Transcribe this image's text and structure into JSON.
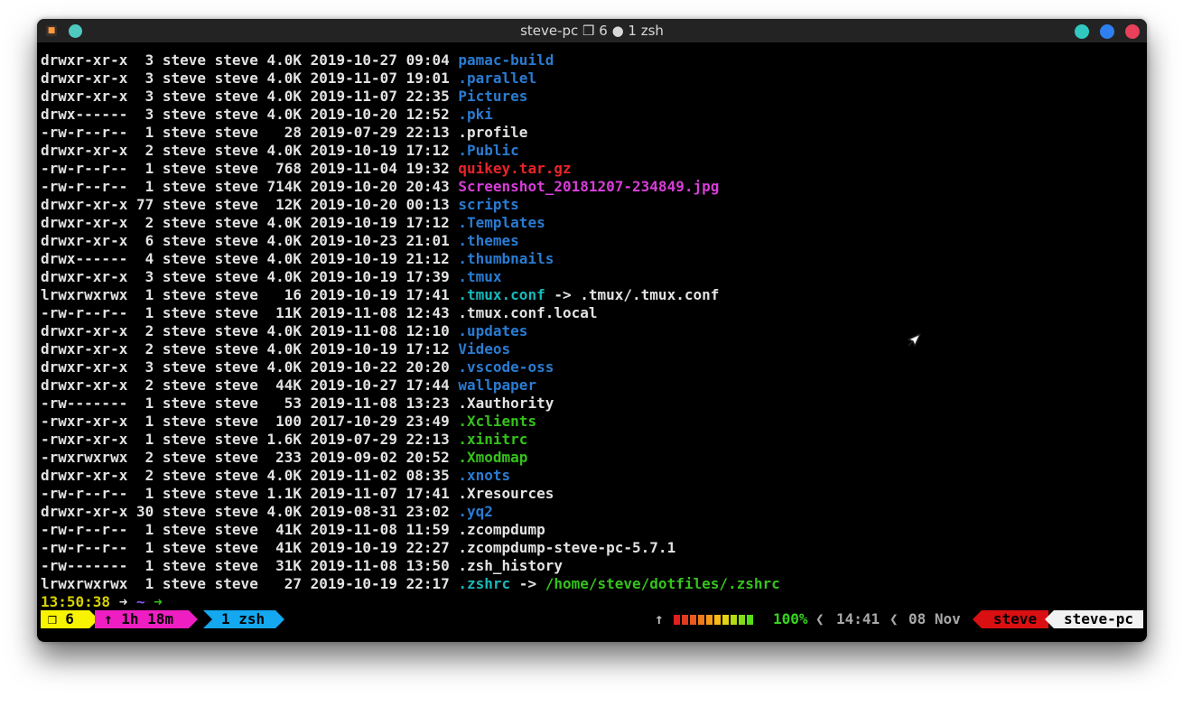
{
  "window": {
    "title": "steve-pc ❒ 6 ● 1 zsh",
    "buttons": [
      "minimize",
      "maximize",
      "close"
    ],
    "button_colors": {
      "pin": "#4fc8c0",
      "minimize": "#30c8c0",
      "maximize": "#2f7ff0",
      "close": "#e8405a"
    }
  },
  "colors": {
    "directory": "#2a7bd2",
    "archive": "#e8242a",
    "image": "#d73ed8",
    "symlink": "#17b9bb",
    "executable": "#35c21c",
    "plain": "#e2e2e2"
  },
  "listing": [
    {
      "meta": "drwxr-xr-x  3 steve steve 4.0K 2019-10-27 09:04 ",
      "name": "pamac-build",
      "kind": "dir"
    },
    {
      "meta": "drwxr-xr-x  3 steve steve 4.0K 2019-11-07 19:01 ",
      "name": ".parallel",
      "kind": "dir"
    },
    {
      "meta": "drwxr-xr-x  3 steve steve 4.0K 2019-11-07 22:35 ",
      "name": "Pictures",
      "kind": "dir"
    },
    {
      "meta": "drwx------  3 steve steve 4.0K 2019-10-20 12:52 ",
      "name": ".pki",
      "kind": "dir"
    },
    {
      "meta": "-rw-r--r--  1 steve steve   28 2019-07-29 22:13 ",
      "name": ".profile",
      "kind": "plain"
    },
    {
      "meta": "drwxr-xr-x  2 steve steve 4.0K 2019-10-19 17:12 ",
      "name": ".Public",
      "kind": "dir"
    },
    {
      "meta": "-rw-r--r--  1 steve steve  768 2019-11-04 19:32 ",
      "name": "quikey.tar.gz",
      "kind": "arch"
    },
    {
      "meta": "-rw-r--r--  1 steve steve 714K 2019-10-20 20:43 ",
      "name": "Screenshot_20181207-234849.jpg",
      "kind": "img"
    },
    {
      "meta": "drwxr-xr-x 77 steve steve  12K 2019-10-20 00:13 ",
      "name": "scripts",
      "kind": "dir"
    },
    {
      "meta": "drwxr-xr-x  2 steve steve 4.0K 2019-10-19 17:12 ",
      "name": ".Templates",
      "kind": "dir"
    },
    {
      "meta": "drwxr-xr-x  6 steve steve 4.0K 2019-10-23 21:01 ",
      "name": ".themes",
      "kind": "dir"
    },
    {
      "meta": "drwx------  4 steve steve 4.0K 2019-10-19 21:12 ",
      "name": ".thumbnails",
      "kind": "dir"
    },
    {
      "meta": "drwxr-xr-x  3 steve steve 4.0K 2019-10-19 17:39 ",
      "name": ".tmux",
      "kind": "dir"
    },
    {
      "meta": "lrwxrwxrwx  1 steve steve   16 2019-10-19 17:41 ",
      "name": ".tmux.conf",
      "kind": "link",
      "arrow": " -> ",
      "target": ".tmux/.tmux.conf",
      "target_kind": "plain"
    },
    {
      "meta": "-rw-r--r--  1 steve steve  11K 2019-11-08 12:43 ",
      "name": ".tmux.conf.local",
      "kind": "plain"
    },
    {
      "meta": "drwxr-xr-x  2 steve steve 4.0K 2019-11-08 12:10 ",
      "name": ".updates",
      "kind": "dir"
    },
    {
      "meta": "drwxr-xr-x  2 steve steve 4.0K 2019-10-19 17:12 ",
      "name": "Videos",
      "kind": "dir"
    },
    {
      "meta": "drwxr-xr-x  3 steve steve 4.0K 2019-10-22 20:20 ",
      "name": ".vscode-oss",
      "kind": "dir"
    },
    {
      "meta": "drwxr-xr-x  2 steve steve  44K 2019-10-27 17:44 ",
      "name": "wallpaper",
      "kind": "dir"
    },
    {
      "meta": "-rw-------  1 steve steve   53 2019-11-08 13:23 ",
      "name": ".Xauthority",
      "kind": "plain"
    },
    {
      "meta": "-rwxr-xr-x  1 steve steve  100 2017-10-29 23:49 ",
      "name": ".Xclients",
      "kind": "exe"
    },
    {
      "meta": "-rwxr-xr-x  1 steve steve 1.6K 2019-07-29 22:13 ",
      "name": ".xinitrc",
      "kind": "exe"
    },
    {
      "meta": "-rwxrwxrwx  2 steve steve  233 2019-09-02 20:52 ",
      "name": ".Xmodmap",
      "kind": "exe"
    },
    {
      "meta": "drwxr-xr-x  2 steve steve 4.0K 2019-11-02 08:35 ",
      "name": ".xnots",
      "kind": "dir"
    },
    {
      "meta": "-rw-r--r--  1 steve steve 1.1K 2019-11-07 17:41 ",
      "name": ".Xresources",
      "kind": "plain"
    },
    {
      "meta": "drwxr-xr-x 30 steve steve 4.0K 2019-08-31 23:02 ",
      "name": ".yq2",
      "kind": "dir"
    },
    {
      "meta": "-rw-r--r--  1 steve steve  41K 2019-11-08 11:59 ",
      "name": ".zcompdump",
      "kind": "plain"
    },
    {
      "meta": "-rw-r--r--  1 steve steve  41K 2019-10-19 22:27 ",
      "name": ".zcompdump-steve-pc-5.7.1",
      "kind": "plain"
    },
    {
      "meta": "-rw-------  1 steve steve  31K 2019-11-08 13:50 ",
      "name": ".zsh_history",
      "kind": "plain"
    },
    {
      "meta": "lrwxrwxrwx  1 steve steve   27 2019-10-19 22:17 ",
      "name": ".zshrc",
      "kind": "link",
      "arrow": " -> ",
      "target": "/home/steve/dotfiles/.zshrc",
      "target_kind": "exe"
    }
  ],
  "prompt": {
    "time": "13:50:38",
    "arrow1": " ➜ ",
    "dir": "~",
    "arrow2": " ➜"
  },
  "statusbar": {
    "session": "❒ 6",
    "uptime": "↑ 1h 18m",
    "window": "1 zsh",
    "up_indicator": "↑",
    "battery_percent": 100,
    "battery_label": "100%",
    "battery_colors": [
      "#e02020",
      "#e43a1e",
      "#ea5a1c",
      "#f07a1a",
      "#f49a18",
      "#f8ba16",
      "#e4d214",
      "#b4da14",
      "#84dc16",
      "#54de18"
    ],
    "separator": "❮",
    "time": "14:41",
    "date": "08 Nov",
    "user": "steve",
    "host": "steve-pc"
  }
}
